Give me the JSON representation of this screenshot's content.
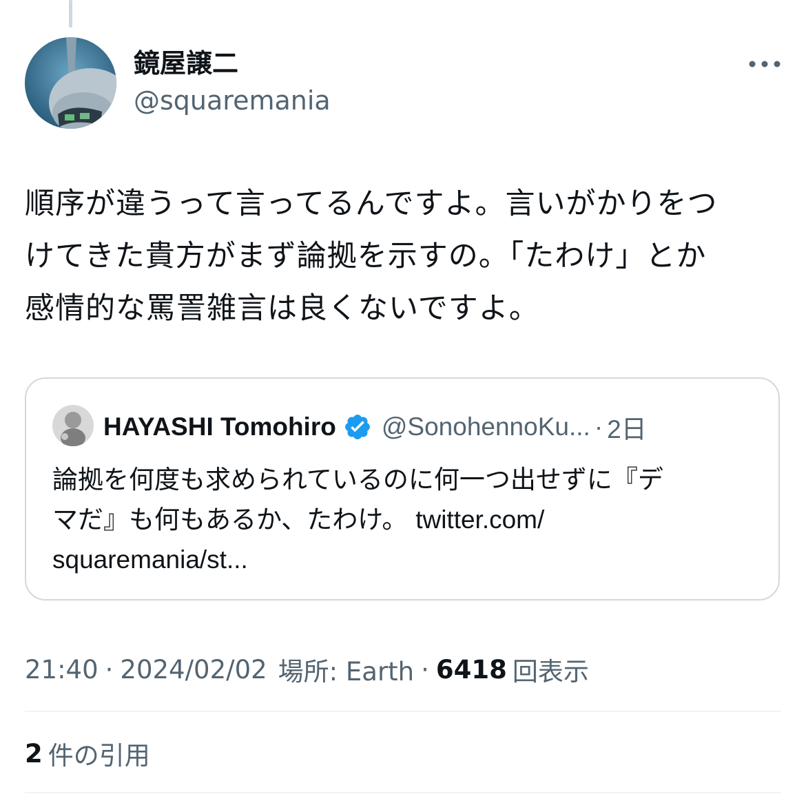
{
  "author": {
    "name": "鏡屋譲二",
    "handle": "@squaremania"
  },
  "tweet": {
    "lines": [
      "順序が違うって言ってるんですよ。言いがかりをつ",
      "けてきた貴方がまず論拠を示すの。「たわけ」とか",
      "感情的な罵詈雑言は良くないですよ。"
    ]
  },
  "quoted": {
    "name": "HAYASHI Tomohiro",
    "handle": "@SonohennoKu...",
    "separator": "·",
    "time": "2日",
    "lines": [
      "論拠を何度も求められているのに何一つ出せずに『デ",
      "マだ』も何もあるか、たわけ。",
      "squaremania/st..."
    ],
    "link_text": "twitter.com/",
    "verified_color": "#1d9bf0"
  },
  "meta": {
    "time": "21:40",
    "date": "2024/02/02",
    "location": "場所: Earth",
    "separator": "·",
    "views_count": "6418",
    "views_label": "回表示"
  },
  "quotes": {
    "count": "2",
    "label": "件の引用"
  },
  "icons": {
    "more": "more-horizontal-icon",
    "verified": "verified-badge-icon"
  },
  "colors": {
    "text": "#0f1419",
    "secondary": "#536471",
    "border": "#cfd9de",
    "accent": "#1d9bf0"
  }
}
